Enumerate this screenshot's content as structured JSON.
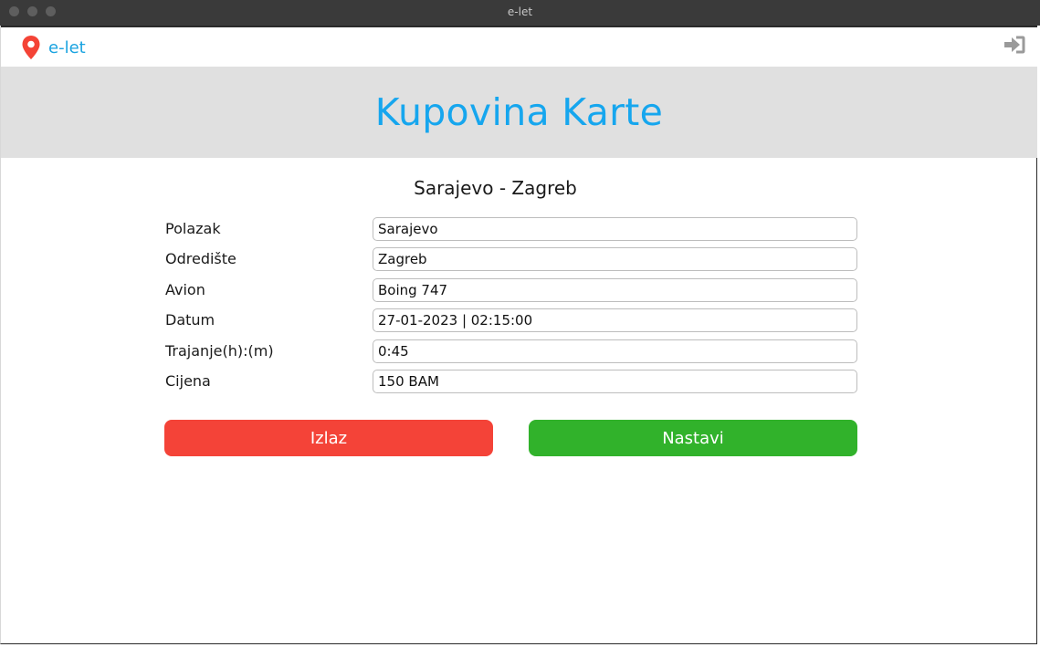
{
  "window": {
    "title": "e-let"
  },
  "navbar": {
    "brand": "e-let",
    "brand_icon": "map-pin-icon",
    "login_icon": "sign-in-icon"
  },
  "hero": {
    "title": "Kupovina Karte"
  },
  "route": {
    "label": "Sarajevo - Zagreb"
  },
  "form": {
    "fields": [
      {
        "label": "Polazak",
        "value": "Sarajevo"
      },
      {
        "label": "Odredište",
        "value": "Zagreb"
      },
      {
        "label": "Avion",
        "value": "Boing 747"
      },
      {
        "label": "Datum",
        "value": "27-01-2023 | 02:15:00"
      },
      {
        "label": "Trajanje(h):(m)",
        "value": "0:45"
      },
      {
        "label": "Cijena",
        "value": "150 BAM"
      }
    ]
  },
  "buttons": {
    "exit": "Izlaz",
    "next": "Nastavi"
  },
  "colors": {
    "accent": "#16a6ee",
    "exit": "#f44338",
    "next": "#31b22b",
    "pin": "#f44336",
    "hero_bg": "#e0e0e0"
  }
}
